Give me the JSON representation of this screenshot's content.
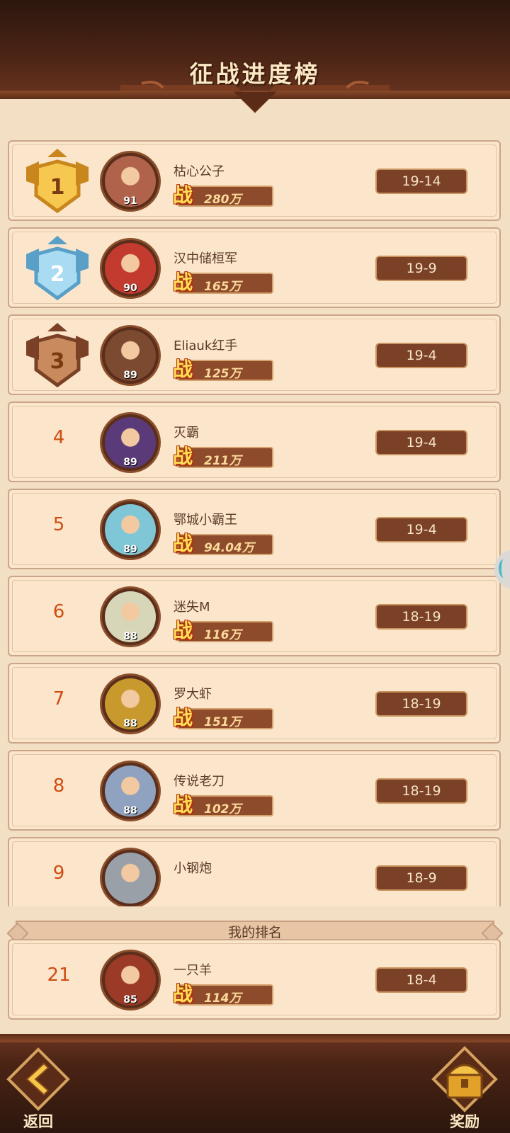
{
  "header": {
    "title": "征战进度榜"
  },
  "rankings": [
    {
      "rank": "1",
      "medal": "gold",
      "name": "枯心公子",
      "level": "91",
      "power": "280万",
      "score": "19-14",
      "color": "#b0624a"
    },
    {
      "rank": "2",
      "medal": "silver",
      "name": "汉中储桓军",
      "level": "90",
      "power": "165万",
      "score": "19-9",
      "color": "#c33a2e"
    },
    {
      "rank": "3",
      "medal": "bronze",
      "name": "Eliauk红手",
      "level": "89",
      "power": "125万",
      "score": "19-4",
      "color": "#7b4a30"
    },
    {
      "rank": "4",
      "medal": "",
      "name": "灭霸",
      "level": "89",
      "power": "211万",
      "score": "19-4",
      "color": "#5b3a7a"
    },
    {
      "rank": "5",
      "medal": "",
      "name": "鄂城小霸王",
      "level": "89",
      "power": "94.04万",
      "score": "19-4",
      "color": "#7fc6d6"
    },
    {
      "rank": "6",
      "medal": "",
      "name": "迷失M",
      "level": "88",
      "power": "116万",
      "score": "18-19",
      "color": "#d8d6b8"
    },
    {
      "rank": "7",
      "medal": "",
      "name": "罗大虾",
      "level": "88",
      "power": "151万",
      "score": "18-19",
      "color": "#c89a2e"
    },
    {
      "rank": "8",
      "medal": "",
      "name": "传说老刀",
      "level": "88",
      "power": "102万",
      "score": "18-19",
      "color": "#8fa2c0"
    },
    {
      "rank": "9",
      "medal": "",
      "name": "小钢炮",
      "level": "",
      "power": "",
      "score": "18-9",
      "color": "#9aa0a8"
    }
  ],
  "my_rank": {
    "label": "我的排名",
    "rank": "21",
    "name": "一只羊",
    "level": "85",
    "power": "114万",
    "score": "18-4",
    "color": "#9b3a26"
  },
  "power_icon_char": "战",
  "footer": {
    "back_label": "返回",
    "reward_label": "奖励"
  },
  "icons": {
    "back": "back-arrow-icon",
    "reward": "treasure-chest-icon"
  }
}
